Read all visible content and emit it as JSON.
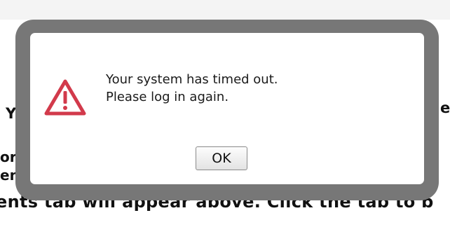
{
  "background": {
    "fragments": [
      "Y",
      "or",
      "en",
      "ents tab will appear above. Click the tab to b",
      "e"
    ]
  },
  "dialog": {
    "icon": "warning-icon",
    "message_line_1": "Your system has timed out.",
    "message_line_2": "Please log in again.",
    "ok_label": "OK"
  },
  "colors": {
    "frame": "#777777",
    "warning": "#d23a4b",
    "panel": "#ffffff"
  }
}
